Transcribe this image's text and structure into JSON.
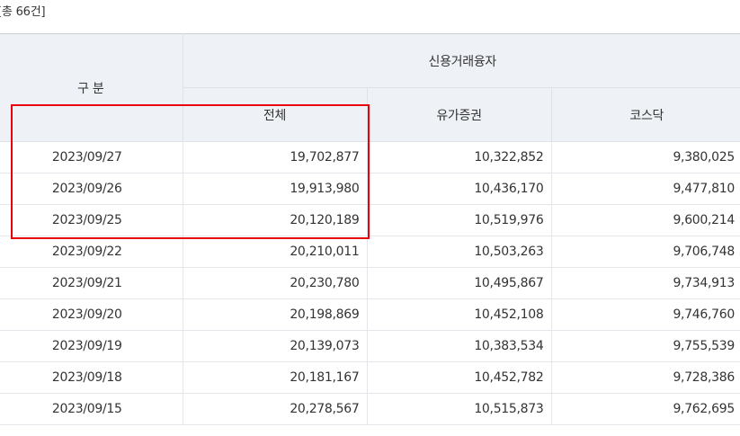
{
  "summary": {
    "total_count": "[총 66건]"
  },
  "table": {
    "header": {
      "category": "구 분",
      "group": "신용거래융자",
      "columns": [
        "전체",
        "유가증권",
        "코스닥"
      ]
    },
    "rows": [
      {
        "date": "2023/09/27",
        "total": "19,702,877",
        "kospi": "10,322,852",
        "kosdaq": "9,380,025"
      },
      {
        "date": "2023/09/26",
        "total": "19,913,980",
        "kospi": "10,436,170",
        "kosdaq": "9,477,810"
      },
      {
        "date": "2023/09/25",
        "total": "20,120,189",
        "kospi": "10,519,976",
        "kosdaq": "9,600,214"
      },
      {
        "date": "2023/09/22",
        "total": "20,210,011",
        "kospi": "10,503,263",
        "kosdaq": "9,706,748"
      },
      {
        "date": "2023/09/21",
        "total": "20,230,780",
        "kospi": "10,495,867",
        "kosdaq": "9,734,913"
      },
      {
        "date": "2023/09/20",
        "total": "20,198,869",
        "kospi": "10,452,108",
        "kosdaq": "9,746,760"
      },
      {
        "date": "2023/09/19",
        "total": "20,139,073",
        "kospi": "10,383,534",
        "kosdaq": "9,755,539"
      },
      {
        "date": "2023/09/18",
        "total": "20,181,167",
        "kospi": "10,452,782",
        "kosdaq": "9,728,386"
      },
      {
        "date": "2023/09/15",
        "total": "20,278,567",
        "kospi": "10,515,873",
        "kosdaq": "9,762,695"
      }
    ]
  },
  "colors": {
    "header_bg": "#eef1f5",
    "highlight_border": "#e8000b"
  }
}
